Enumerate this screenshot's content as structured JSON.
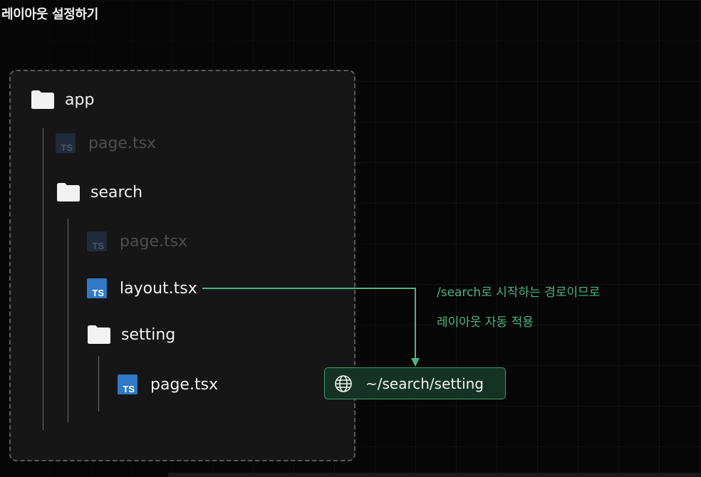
{
  "title": "레이아웃 설정하기",
  "tree": [
    {
      "id": "app",
      "type": "folder",
      "label": "app",
      "depth": 0,
      "dim": false
    },
    {
      "id": "app-page",
      "type": "ts",
      "label": "page.tsx",
      "depth": 1,
      "dim": true
    },
    {
      "id": "search",
      "type": "folder",
      "label": "search",
      "depth": 1,
      "dim": false
    },
    {
      "id": "search-page",
      "type": "ts",
      "label": "page.tsx",
      "depth": 2,
      "dim": true
    },
    {
      "id": "search-layout",
      "type": "ts",
      "label": "layout.tsx",
      "depth": 2,
      "dim": false
    },
    {
      "id": "setting",
      "type": "folder",
      "label": "setting",
      "depth": 2,
      "dim": false
    },
    {
      "id": "setting-page",
      "type": "ts",
      "label": "page.tsx",
      "depth": 3,
      "dim": false
    }
  ],
  "ts_badge": "TS",
  "annotation": {
    "line1": "/search로 시작하는 경로이므로",
    "line2": "레이아웃 자동 적용"
  },
  "route": {
    "icon": "globe-icon",
    "path": "~/search/setting"
  },
  "colors": {
    "accent": "#4fb485",
    "ts_blue": "#3178c6",
    "ts_blue_dim": "#1f2a3a",
    "folder": "#f2f2f2"
  }
}
